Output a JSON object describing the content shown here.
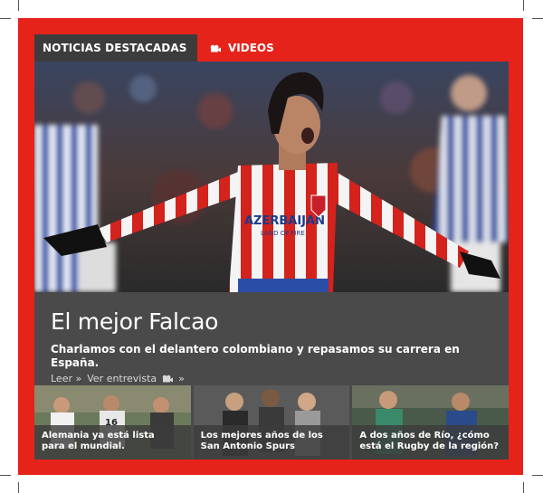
{
  "tabs": {
    "news_label": "NOTICIAS DESTACADAS",
    "videos_label": "VIDEOS",
    "videos_icon": "video-camera-icon"
  },
  "featured": {
    "title": "El mejor Falcao",
    "summary": "Charlamos con el delantero colombiano y repasamos su carrera en España.",
    "read_link": "Leer »",
    "watch_link": "Ver entrevista",
    "watch_suffix": "»",
    "jersey_text": "AZERBAIJAN",
    "jersey_subtext": "LAND OF FIRE"
  },
  "thumbnails": [
    {
      "caption_line1": "Alemania ya está lista",
      "caption_line2": "para el mundial."
    },
    {
      "caption_line1": "Los mejores años de los",
      "caption_line2": "San Antonio Spurs"
    },
    {
      "caption_line1": "A dos años de Río, ¿cómo",
      "caption_line2": "está el Rugby de la región?"
    }
  ],
  "colors": {
    "accent": "#e5231b",
    "panel": "#4a4a4a",
    "tab_dark": "#3c3c3c"
  }
}
